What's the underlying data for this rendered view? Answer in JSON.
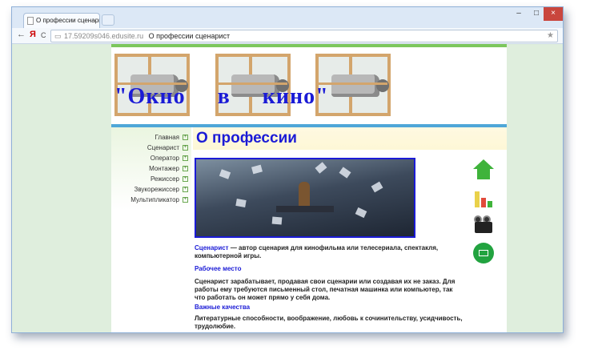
{
  "browser": {
    "tab_title": "О профессии сценарист",
    "tab_close": "×",
    "back": "←",
    "yandex": "Я",
    "reload": "C",
    "address_host": "17.59209s046.edusite.ru",
    "address_title": "О профессии сценарист",
    "minimize": "–",
    "maximize": "□",
    "close": "×",
    "star": "★"
  },
  "site": {
    "header_title": "\"Окно в кино\"",
    "nav": [
      {
        "label": "Главная"
      },
      {
        "label": "Сценарист"
      },
      {
        "label": "Оператор"
      },
      {
        "label": "Монтажер"
      },
      {
        "label": "Режиссер"
      },
      {
        "label": "Звукорежиссер"
      },
      {
        "label": "Мультипликатор"
      }
    ],
    "nav_plus": "+"
  },
  "content": {
    "heading": "О профессии",
    "intro_term": "Сценарист",
    "intro_text": " — автор сценария для кинофильма или телесериала, спектакля, компьютерной игры.",
    "section1_title": "Рабочее место",
    "section1_text": "Сценарист зарабатывает, продавая свои сценарии или создавая их не заказ. Для работы ему требуются письменный стол, печатная машинка или компьютер, так что работать он может прямо у себя дома.",
    "section2_title": "Важные качества",
    "section2_text": "Литературные способности, воображение, любовь к сочинительству, усидчивость, трудолюбие."
  },
  "colors": {
    "accent_blue": "#1b1bd6",
    "green_bar": "#7dc75d",
    "blue_bar": "#4fa7d8"
  },
  "icons": [
    "home-icon",
    "chart-icon",
    "film-icon",
    "mail-icon"
  ]
}
